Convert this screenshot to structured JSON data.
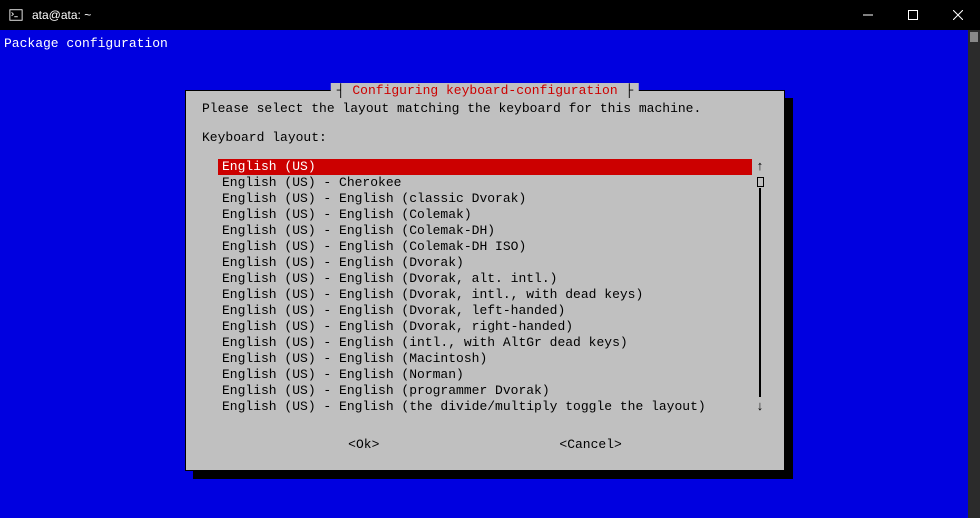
{
  "titlebar": {
    "title": "ata@ata: ~"
  },
  "terminal": {
    "header": "Package configuration"
  },
  "dialog": {
    "title": "Configuring keyboard-configuration",
    "prompt": "Please select the layout matching the keyboard for this machine.",
    "label": "Keyboard layout:",
    "items": [
      "English (US)",
      "English (US) - Cherokee",
      "English (US) - English (classic Dvorak)",
      "English (US) - English (Colemak)",
      "English (US) - English (Colemak-DH)",
      "English (US) - English (Colemak-DH ISO)",
      "English (US) - English (Dvorak)",
      "English (US) - English (Dvorak, alt. intl.)",
      "English (US) - English (Dvorak, intl., with dead keys)",
      "English (US) - English (Dvorak, left-handed)",
      "English (US) - English (Dvorak, right-handed)",
      "English (US) - English (intl., with AltGr dead keys)",
      "English (US) - English (Macintosh)",
      "English (US) - English (Norman)",
      "English (US) - English (programmer Dvorak)",
      "English (US) - English (the divide/multiply toggle the layout)"
    ],
    "selected_index": 0,
    "ok_label": "<Ok>",
    "cancel_label": "<Cancel>"
  }
}
